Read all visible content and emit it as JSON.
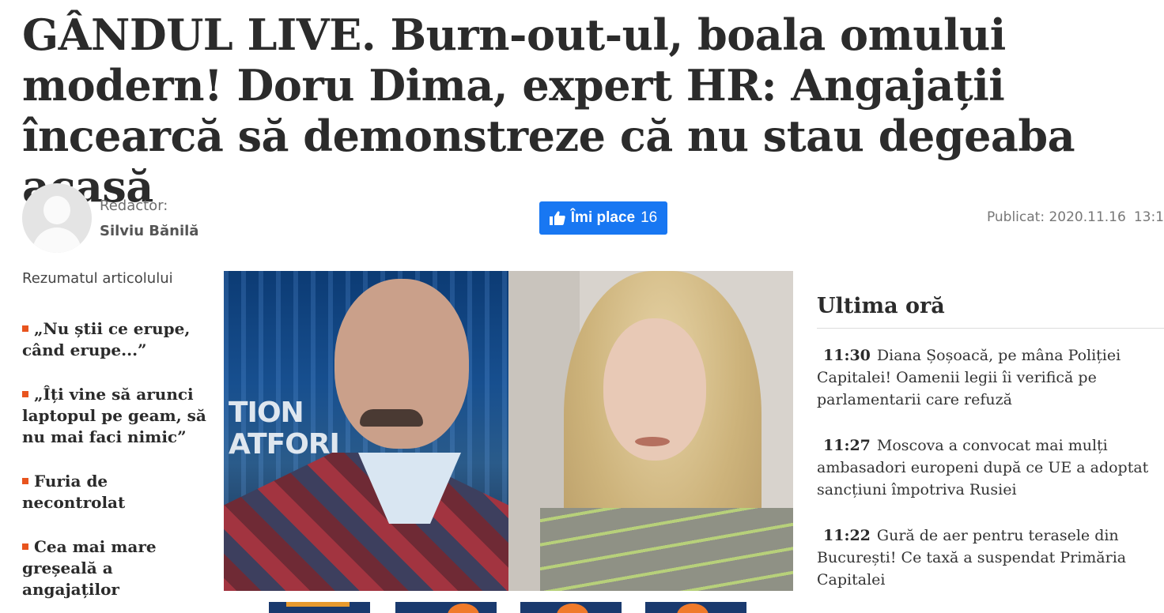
{
  "article": {
    "headline": "GÂNDUL LIVE. Burn-out-ul, boala omului modern! Doru Dima, expert HR: Angajații încearcă să demonstreze că nu stau degeaba acasă"
  },
  "author": {
    "label": "Redactor:",
    "name": "Silviu Bănilă"
  },
  "like_button": {
    "label": "Îmi place",
    "count": "16",
    "color": "#1877f2"
  },
  "published": {
    "label": "Publicat: 2020.11.16",
    "time": "13:1"
  },
  "summary": {
    "title": "Rezumatul articolului",
    "items": [
      "„Nu știi ce erupe, când erupe...”",
      "„Îți vine să arunci laptopul pe geam, să nu mai faci nimic”",
      "Furia de necontrolat",
      "Cea mai mare greșeală a angajaților"
    ],
    "bullet_color": "#e8541e"
  },
  "video": {
    "overlay_text_line1": "TION",
    "overlay_text_line2": "ATFORI"
  },
  "sidebar": {
    "title": "Ultima oră",
    "items": [
      {
        "time": "11:30",
        "text": "Diana Șoșoacă, pe mâna Poliției Capitalei! Oamenii legii îi verifică pe parlamentarii care refuză"
      },
      {
        "time": "11:27",
        "text": "Moscova a convocat mai mulți ambasadori europeni după ce UE a adoptat sancțiuni împotriva Rusiei"
      },
      {
        "time": "11:22",
        "text": "Gură de aer pentru terasele din București! Ce taxă a suspendat Primăria Capitalei"
      }
    ]
  }
}
